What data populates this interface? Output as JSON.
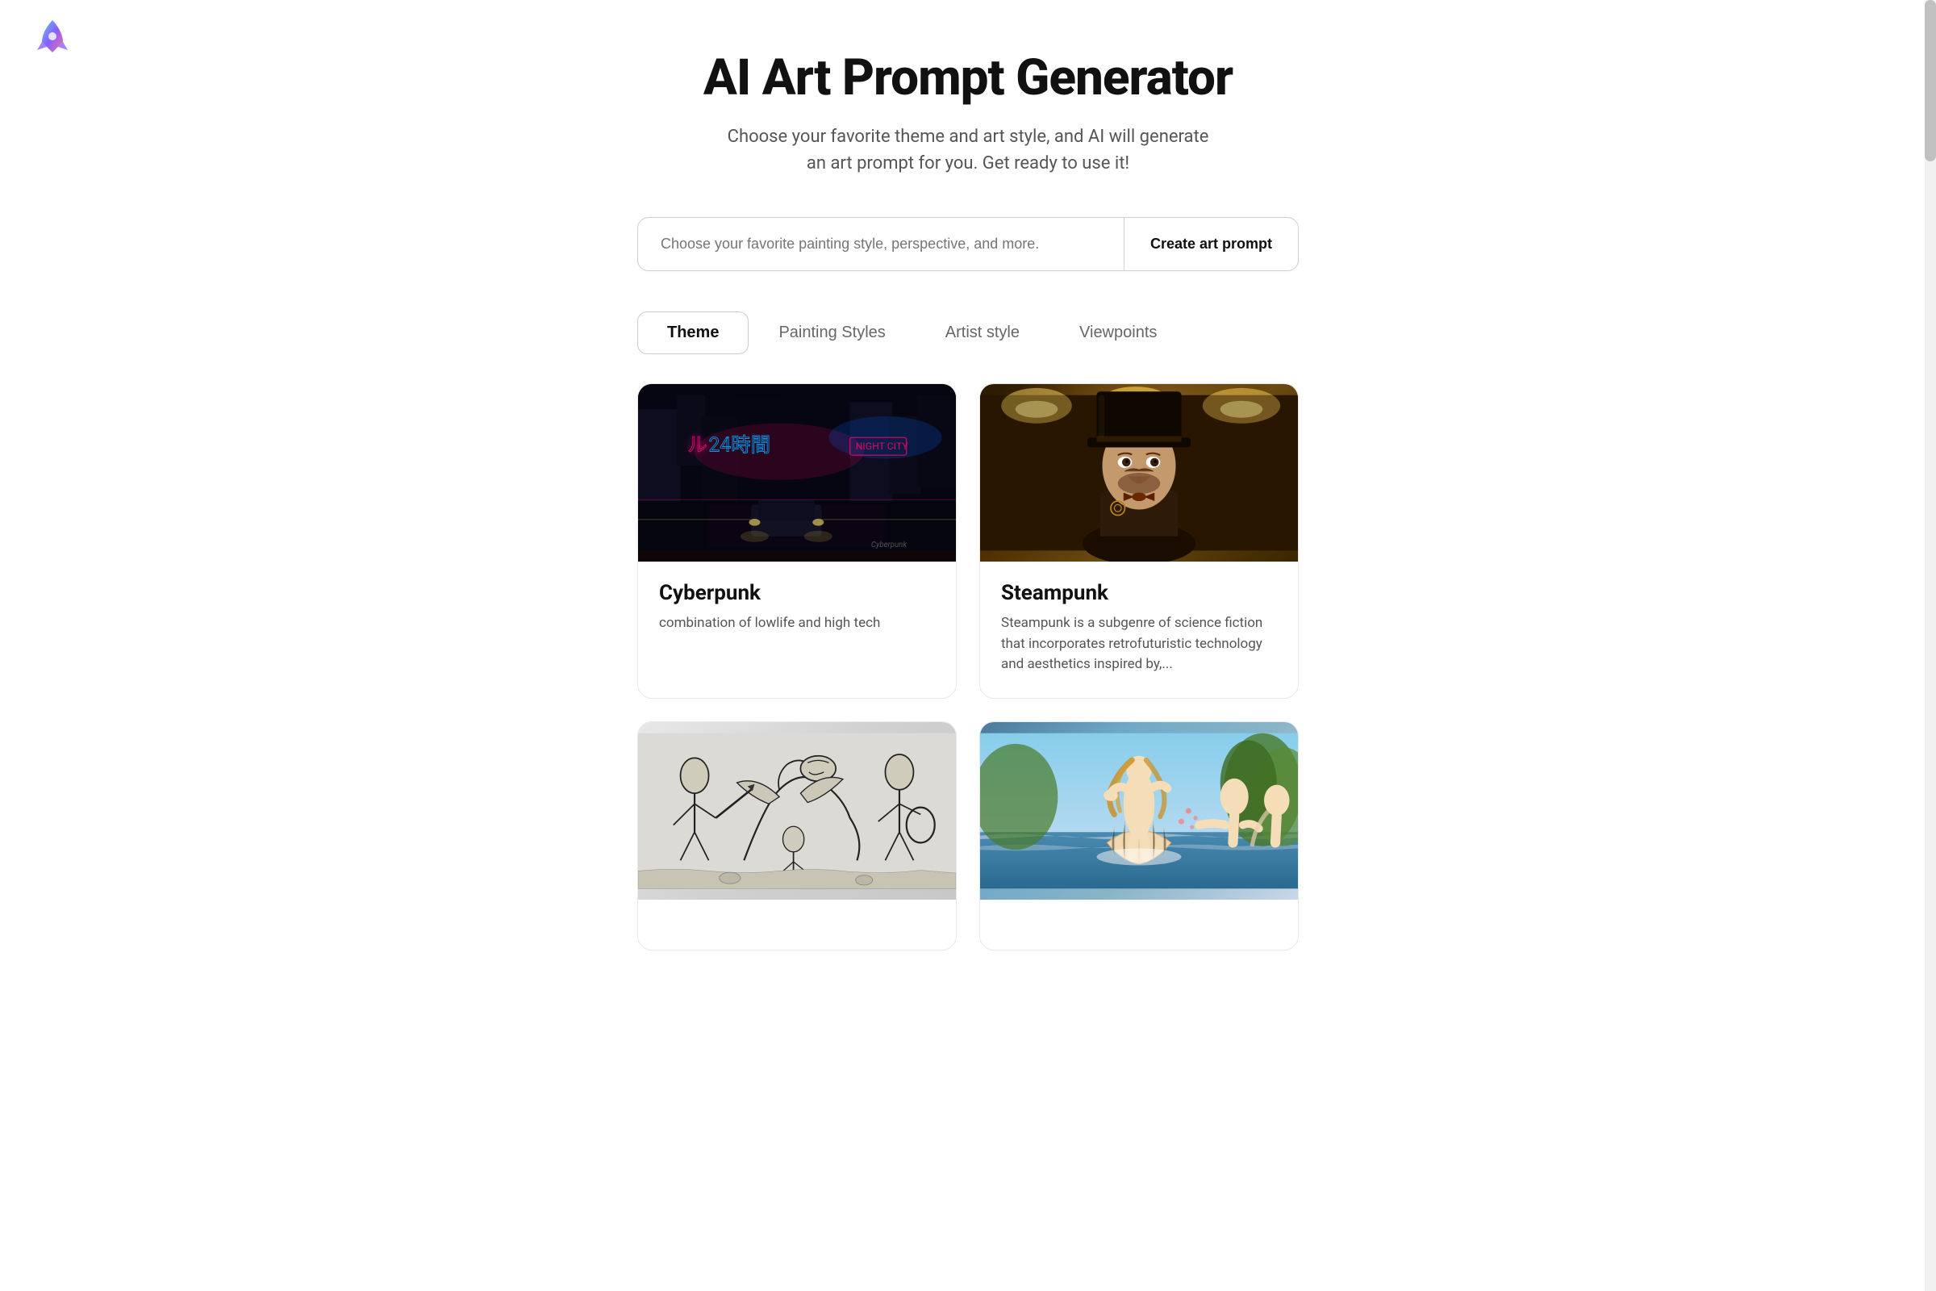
{
  "app": {
    "logo_alt": "AI Art App Logo"
  },
  "header": {
    "title": "AI Art Prompt Generator",
    "subtitle": "Choose your favorite theme and art style, and AI will generate an art prompt for you. Get ready to use it!"
  },
  "search": {
    "placeholder": "Choose your favorite painting style, perspective, and more.",
    "button_label": "Create art prompt"
  },
  "tabs": [
    {
      "id": "theme",
      "label": "Theme",
      "active": true
    },
    {
      "id": "painting-styles",
      "label": "Painting Styles",
      "active": false
    },
    {
      "id": "artist-style",
      "label": "Artist style",
      "active": false
    },
    {
      "id": "viewpoints",
      "label": "Viewpoints",
      "active": false
    }
  ],
  "cards": [
    {
      "id": "cyberpunk",
      "title": "Cyberpunk",
      "description": "combination of lowlife and high tech",
      "image_type": "cyberpunk"
    },
    {
      "id": "steampunk",
      "title": "Steampunk",
      "description": "Steampunk is a subgenre of science fiction that incorporates retrofuturistic technology and aesthetics inspired by,...",
      "image_type": "steampunk"
    },
    {
      "id": "sketch",
      "title": "",
      "description": "",
      "image_type": "sketch"
    },
    {
      "id": "renaissance",
      "title": "",
      "description": "",
      "image_type": "renaissance"
    }
  ]
}
